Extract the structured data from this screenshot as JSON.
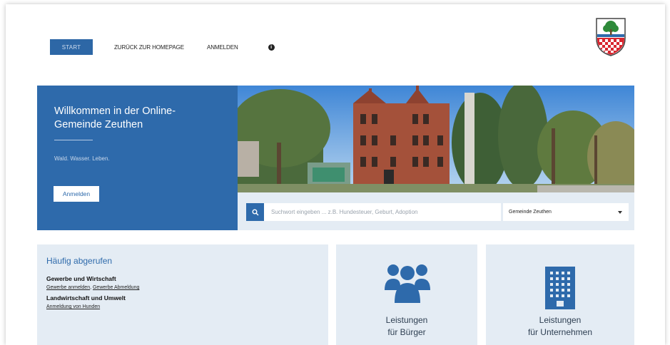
{
  "nav": {
    "start_label": "START",
    "items": [
      {
        "label": "ZURÜCK ZUR HOMEPAGE"
      },
      {
        "label": "ANMELDEN"
      }
    ]
  },
  "hero": {
    "title": "Willkommen in der Online-Gemeinde Zeuthen",
    "subtitle": "Wald. Wasser. Leben.",
    "login_button": "Anmelden"
  },
  "search": {
    "placeholder": "Suchwort eingeben ... z.B. Hundesteuer, Geburt, Adoption",
    "location_select": "Gemeinde Zeuthen"
  },
  "frequently": {
    "title": "Häufig abgerufen",
    "groups": [
      {
        "category": "Gewerbe und Wirtschaft",
        "links": [
          "Gewerbe anmelden",
          "Gewerbe Abmeldung"
        ]
      },
      {
        "category": "Landwirtschaft und Umwelt",
        "links": [
          "Anmeldung von Hunden"
        ]
      }
    ]
  },
  "cards": {
    "buerger": {
      "line1": "Leistungen",
      "line2": "für Bürger"
    },
    "unternehmen": {
      "line1": "Leistungen",
      "line2": "für Unternehmen"
    }
  },
  "colors": {
    "primary": "#2e6aab",
    "panel": "#e4ecf4",
    "text_dark": "#2e3f52"
  },
  "icons": [
    "info-icon",
    "coat-of-arms",
    "search-icon",
    "chevron-down-icon",
    "people-icon",
    "building-icon"
  ]
}
